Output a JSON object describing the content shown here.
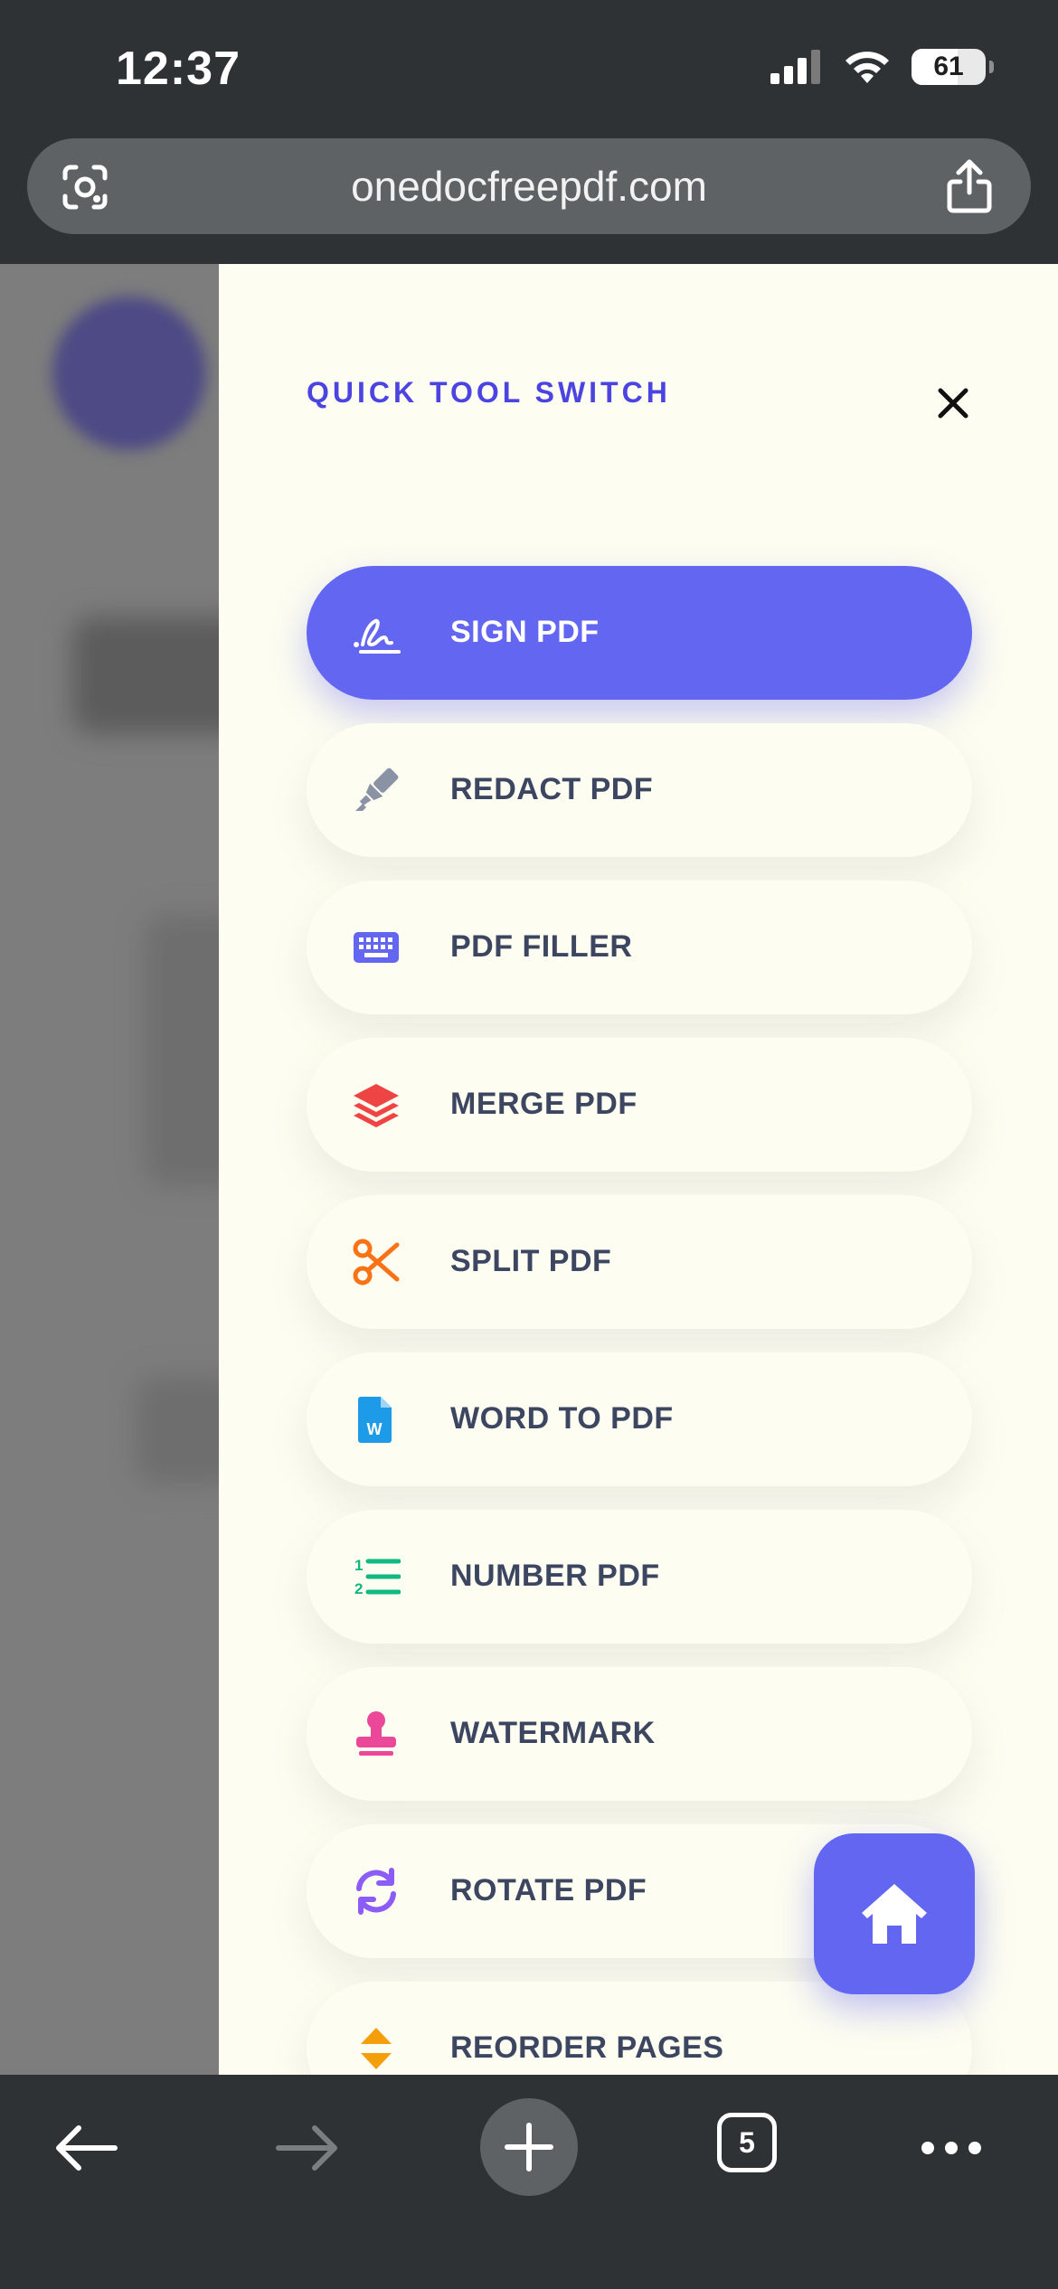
{
  "status_bar": {
    "time": "12:37",
    "battery": "61"
  },
  "browser": {
    "url": "onedocfreepdf.com",
    "tab_count": "5"
  },
  "panel": {
    "heading": "QUICK TOOL SWITCH",
    "tools": [
      {
        "label": "SIGN PDF",
        "icon": "signature-icon",
        "color": "#ffffff",
        "active": true
      },
      {
        "label": "REDACT PDF",
        "icon": "highlighter-icon",
        "color": "#8a93a6"
      },
      {
        "label": "PDF FILLER",
        "icon": "keyboard-icon",
        "color": "#6366f1"
      },
      {
        "label": "MERGE PDF",
        "icon": "layers-icon",
        "color": "#ef4444"
      },
      {
        "label": "SPLIT PDF",
        "icon": "scissors-icon",
        "color": "#f97316"
      },
      {
        "label": "WORD TO PDF",
        "icon": "word-file-icon",
        "color": "#1e9be8"
      },
      {
        "label": "NUMBER PDF",
        "icon": "numbered-list-icon",
        "color": "#10b981"
      },
      {
        "label": "WATERMARK",
        "icon": "stamp-icon",
        "color": "#ec4899"
      },
      {
        "label": "ROTATE PDF",
        "icon": "rotate-icon",
        "color": "#8b5cf6"
      },
      {
        "label": "REORDER PAGES",
        "icon": "sort-icon",
        "color": "#f59e0b"
      }
    ]
  },
  "colors": {
    "accent": "#6366f1",
    "heading": "#4c44e0",
    "panel_bg": "#fdfdf1",
    "chrome": "#2f3234"
  }
}
